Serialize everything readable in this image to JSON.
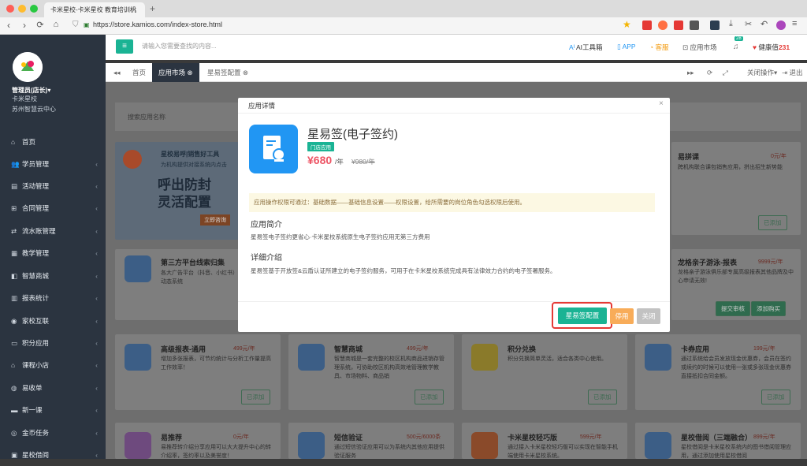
{
  "browser": {
    "tab_title": "卡米星校-卡米星校 教育培训机",
    "new_tab": "+",
    "url": "https://store.kamios.com/index-store.html"
  },
  "sidebar": {
    "user": "管理员(店长)",
    "user_caret": "▾",
    "school": "卡米星校",
    "center": "苏州智慧云中心",
    "items": [
      {
        "label": "首页",
        "icon": "home-icon",
        "glyph": "⌂",
        "has_arrow": false
      },
      {
        "label": "学员管理",
        "icon": "users-icon",
        "glyph": "👥",
        "has_arrow": true
      },
      {
        "label": "活动管理",
        "icon": "book-icon",
        "glyph": "▤",
        "has_arrow": true
      },
      {
        "label": "合同管理",
        "icon": "cart-icon",
        "glyph": "⊞",
        "has_arrow": true
      },
      {
        "label": "流水账管理",
        "icon": "exchange-icon",
        "glyph": "⇄",
        "has_arrow": true
      },
      {
        "label": "教学管理",
        "icon": "calendar-icon",
        "glyph": "▦",
        "has_arrow": true
      },
      {
        "label": "智慧商城",
        "icon": "shopping-icon",
        "glyph": "◧",
        "has_arrow": true
      },
      {
        "label": "报表统计",
        "icon": "chart-icon",
        "glyph": "▥",
        "has_arrow": true
      },
      {
        "label": "家校互联",
        "icon": "chat-icon",
        "glyph": "◉",
        "has_arrow": true
      },
      {
        "label": "积分应用",
        "icon": "credit-icon",
        "glyph": "▭",
        "has_arrow": true
      },
      {
        "label": "课程小店",
        "icon": "store-icon",
        "glyph": "⌂",
        "has_arrow": true
      },
      {
        "label": "易收单",
        "icon": "user-add-icon",
        "glyph": "◍",
        "has_arrow": true
      },
      {
        "label": "新一课",
        "icon": "minus-icon",
        "glyph": "▬",
        "has_arrow": true
      },
      {
        "label": "金币任务",
        "icon": "coin-icon",
        "glyph": "◎",
        "has_arrow": true
      },
      {
        "label": "星校借阅",
        "icon": "book-open-icon",
        "glyph": "▣",
        "has_arrow": true
      }
    ]
  },
  "header": {
    "menu_glyph": "≡",
    "search_placeholder": "请输入您需要查找的内容...",
    "ai_tools": "AI工具箱",
    "ai_glyph": "Aᴵ",
    "app": "APP",
    "service": "客服",
    "market": "应用市场",
    "notify_count": "28",
    "health_label": "健康值",
    "health_value": "231"
  },
  "navtabs": {
    "back_glyph": "◂◂",
    "forward_glyph": "▸▸",
    "refresh_glyph": "⟳",
    "fullscreen_glyph": "⤢",
    "home": "首页",
    "active": "应用市场",
    "other": "星易签配置",
    "close_ops": "关闭操作▾",
    "logout": "退出"
  },
  "store": {
    "search_placeholder": "搜索应用名称",
    "banner_title": "星校易呼|销售好工具",
    "banner_desc": "为机构提供对接系统内点击",
    "banner_big1": "呼出防封",
    "banner_big2": "灵活配置",
    "banner_button": "立即咨询",
    "cards": [
      {
        "title": "易拼课",
        "price": "0元/年",
        "desc": "跨机构联合课包销售应用，拼出招生新势能",
        "btn": "已添加"
      },
      {
        "title": "第三方平台线索归集",
        "price": "",
        "desc": "各大广告平台（抖音、小红书）动态系统",
        "btn": ""
      },
      {
        "title": "龙格亲子游泳-报表",
        "price": "9999元/年",
        "desc": "龙格亲子游泳俱乐部专属高级报表其他品牌及中心申请无效!",
        "btn": "提交审核",
        "btn2": "添加购买"
      },
      {
        "title": "高级报表-通用",
        "price": "499元/年",
        "desc": "增加多张报表，可节约统计与分析工作量提高工作效率！",
        "btn": "已添加"
      },
      {
        "title": "智慧商城",
        "price": "499元/年",
        "desc": "智慧商城是一套完整的校区机构商品进销存管理系统，可协助校区机构高效地管理教学教具、市场物料、商品销",
        "btn": "已添加"
      },
      {
        "title": "积分兑换",
        "price": "",
        "desc": "积分兑换简单灵活，适合各类中心使用。",
        "btn": "已添加"
      },
      {
        "title": "卡券应用",
        "price": "199元/年",
        "desc": "通过系统给会员发放现金优惠券，会员在签约或续约的时候可以使用一张或多张现金优惠券直接抵扣合同金额。",
        "btn": "已添加"
      },
      {
        "title": "易推荐",
        "price": "0元/年",
        "desc": "易推荐转介绍分享应用可以大大提升中心的转介绍率，签约率以及美誉度！",
        "btn": ""
      },
      {
        "title": "短信验证",
        "price": "500元/6000条",
        "desc": "通过短信验证应用可以为系统内其他应用提供验证服务",
        "btn": ""
      },
      {
        "title": "卡米星校轻巧版",
        "price": "599元/年",
        "desc": "通过接入卡米星校轻巧版可以实现在智能手机端使用卡米星校系统。",
        "btn": ""
      },
      {
        "title": "星校借阅（三端融合）",
        "price": "899元/年",
        "desc": "星校借阅是卡米星校系统内的图书借阅管理应用，通过添加使用星校借阅",
        "btn": ""
      }
    ]
  },
  "modal": {
    "header": "应用详情",
    "close_glyph": "×",
    "app_title": "星易签(电子签约)",
    "tag": "门店应用",
    "price": "¥680",
    "price_unit": "/年",
    "old_price": "¥980/年",
    "notice": "应用操作权限可通过：基础数据——基础信息设置——权限设置，给所需要的岗位角色勾选权限后使用。",
    "intro_title": "应用简介",
    "intro_text": "星易签电子签约更省心·卡米星校系统原生电子签约应用无第三方费用",
    "detail_title": "详细介绍",
    "detail_text": "星易签基于开放签&云盾认证所建立的电子签约服务，可用于在卡米星校系统完成具有法律效力合约的电子签署服务。",
    "btn_config": "星易签配置",
    "btn_stop": "停用",
    "btn_close": "关闭"
  },
  "colors": {
    "accent": "#1ab394",
    "danger": "#ed5565",
    "warning": "#f8ac59",
    "sidebar": "#2b3440",
    "highlight": "#e53935"
  }
}
